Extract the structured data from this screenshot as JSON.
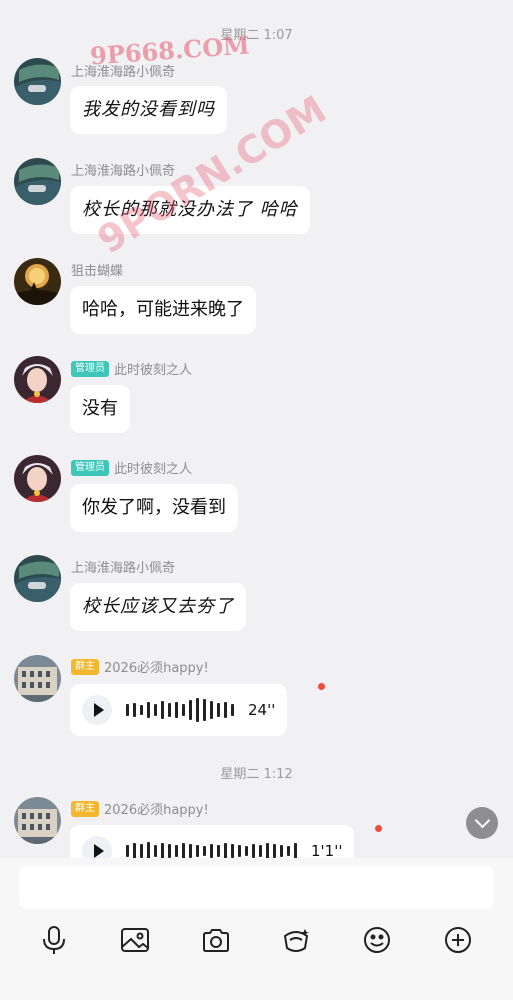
{
  "timestamps": [
    "星期二 1:07",
    "星期二 1:12"
  ],
  "watermarks": [
    "9P668.COM",
    "9PORN.COM"
  ],
  "messages": [
    {
      "sender": "上海淮海路小佩奇",
      "badge": "",
      "text": "我发的没看到吗"
    },
    {
      "sender": "上海淮海路小佩奇",
      "badge": "",
      "text": "校长的那就没办法了 哈哈"
    },
    {
      "sender": "狙击蝴蝶",
      "badge": "",
      "text": "哈哈，可能进来晚了"
    },
    {
      "sender": "此时彼刻之人",
      "badge": "管理员",
      "text": "没有"
    },
    {
      "sender": "此时彼刻之人",
      "badge": "管理员",
      "text": "你发了啊，没看到"
    },
    {
      "sender": "上海淮海路小佩奇",
      "badge": "",
      "text": "校长应该又去夯了"
    },
    {
      "sender": "2026必须happy!",
      "badge": "群主",
      "duration": "24''"
    },
    {
      "sender": "2026必须happy!",
      "badge": "群主",
      "duration": "1'1''"
    }
  ],
  "input": {
    "placeholder": ""
  },
  "toolbar": [
    "microphone-icon",
    "image-icon",
    "camera-icon",
    "red-packet-icon",
    "emoji-icon",
    "plus-icon"
  ],
  "colors": {
    "unread": "#f04b3c",
    "admin_badge": "#3cc7b8",
    "owner_badge": "#f3b72e",
    "watermark": "#e65a6e"
  }
}
